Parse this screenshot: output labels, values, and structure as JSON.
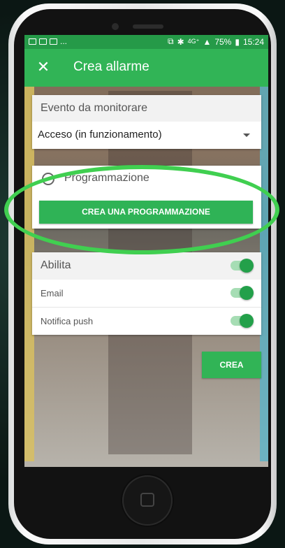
{
  "statusbar": {
    "left_icons": [
      "message-icon",
      "video-icon",
      "image-icon"
    ],
    "left_more": "...",
    "right": {
      "network": "4G⁺",
      "battery": "75%",
      "time": "15:24"
    }
  },
  "appbar": {
    "close_glyph": "✕",
    "title": "Crea allarme"
  },
  "event_card": {
    "label": "Evento da monitorare",
    "selected_value": "Acceso (in funzionamento)"
  },
  "schedule_card": {
    "label": "Programmazione",
    "button": "CREA UNA PROGRAMMAZIONE"
  },
  "enable_card": {
    "title": "Abilita",
    "items": [
      {
        "label": "Email",
        "enabled": true
      },
      {
        "label": "Notifica push",
        "enabled": true
      }
    ],
    "title_enabled": true
  },
  "create_button": {
    "label": "CREA"
  },
  "colors": {
    "primary": "#31b456",
    "statusbar": "#259a48",
    "highlight": "#40cf50"
  }
}
